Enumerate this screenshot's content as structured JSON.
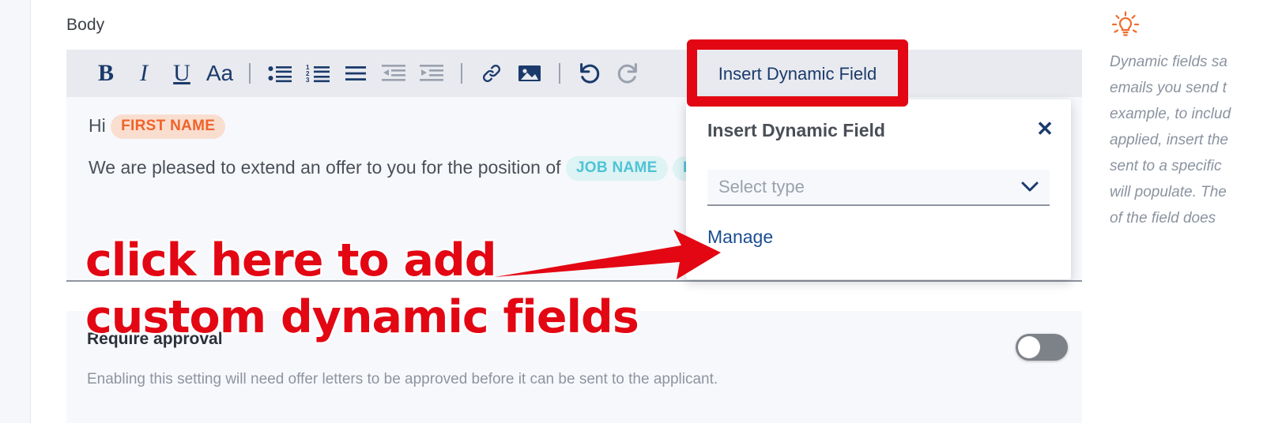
{
  "left_rail": {
    "name": "collapsed-navigation-rail"
  },
  "editor": {
    "field_label": "Body",
    "toolbar": {
      "bold": "B",
      "italic": "I",
      "underline": "U",
      "font_size": "Aa",
      "bulleted_list": "bulleted-list-icon",
      "numbered_list": "numbered-list-icon",
      "align": "align-icon",
      "outdent": "outdent-icon",
      "indent": "indent-icon",
      "link": "link-icon",
      "image": "image-icon",
      "undo": "undo-icon",
      "redo": "redo-icon",
      "insert_dynamic_field": "Insert Dynamic Field"
    },
    "content": {
      "line1_prefix": "Hi",
      "chip_first_name": "FIRST NAME",
      "line2_text": "We are pleased to extend an offer to you for the position of",
      "chip_job_name": "JOB NAME",
      "chip_pay_type": "PAY TYPE",
      "line2_suffix": "."
    }
  },
  "popup": {
    "title": "Insert Dynamic Field",
    "close_icon": "close-icon",
    "select_placeholder": "Select type",
    "caret_icon": "chevron-down-icon",
    "manage_link": "Manage"
  },
  "approval": {
    "title": "Require approval",
    "description": "Enabling this setting will need offer letters to be approved before it can be sent to the applicant.",
    "toggle_state": "off"
  },
  "tip_panel": {
    "icon": "lightbulb-idea-icon",
    "text": "Dynamic fields sa\nemails you send t\nexample, to includ\napplied, insert the\nsent to a specific\nwill populate. The\nof the field does"
  },
  "annotations": {
    "callout_line1": "click here to add",
    "callout_line2": "custom dynamic fields",
    "arrow": "red-arrow-pointing-right",
    "highlight_box": "red-rectangle-highlight",
    "color": "#e30613"
  }
}
